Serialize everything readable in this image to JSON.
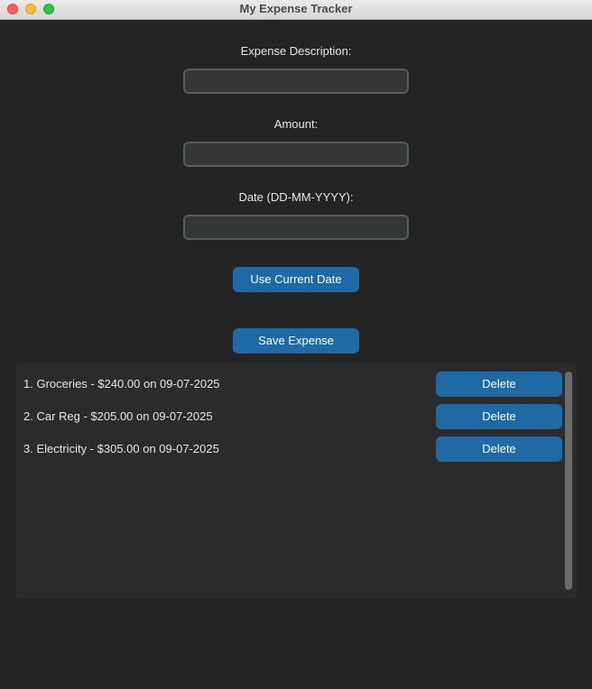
{
  "window": {
    "title": "My Expense Tracker"
  },
  "form": {
    "description_label": "Expense Description:",
    "description_value": "",
    "amount_label": "Amount:",
    "amount_value": "",
    "date_label": "Date (DD-MM-YYYY):",
    "date_value": "",
    "use_current_date_label": "Use Current Date",
    "save_label": "Save Expense"
  },
  "expenses": {
    "items": [
      {
        "text": "1. Groceries - $240.00 on 09-07-2025",
        "delete_label": "Delete"
      },
      {
        "text": "2. Car Reg - $205.00 on 09-07-2025",
        "delete_label": "Delete"
      },
      {
        "text": "3. Electricity - $305.00 on 09-07-2025",
        "delete_label": "Delete"
      }
    ]
  },
  "colors": {
    "accent": "#1f6aa5",
    "background": "#242424",
    "panel": "#2b2b2b",
    "input_bg": "#343638",
    "input_border": "#565b5e"
  }
}
